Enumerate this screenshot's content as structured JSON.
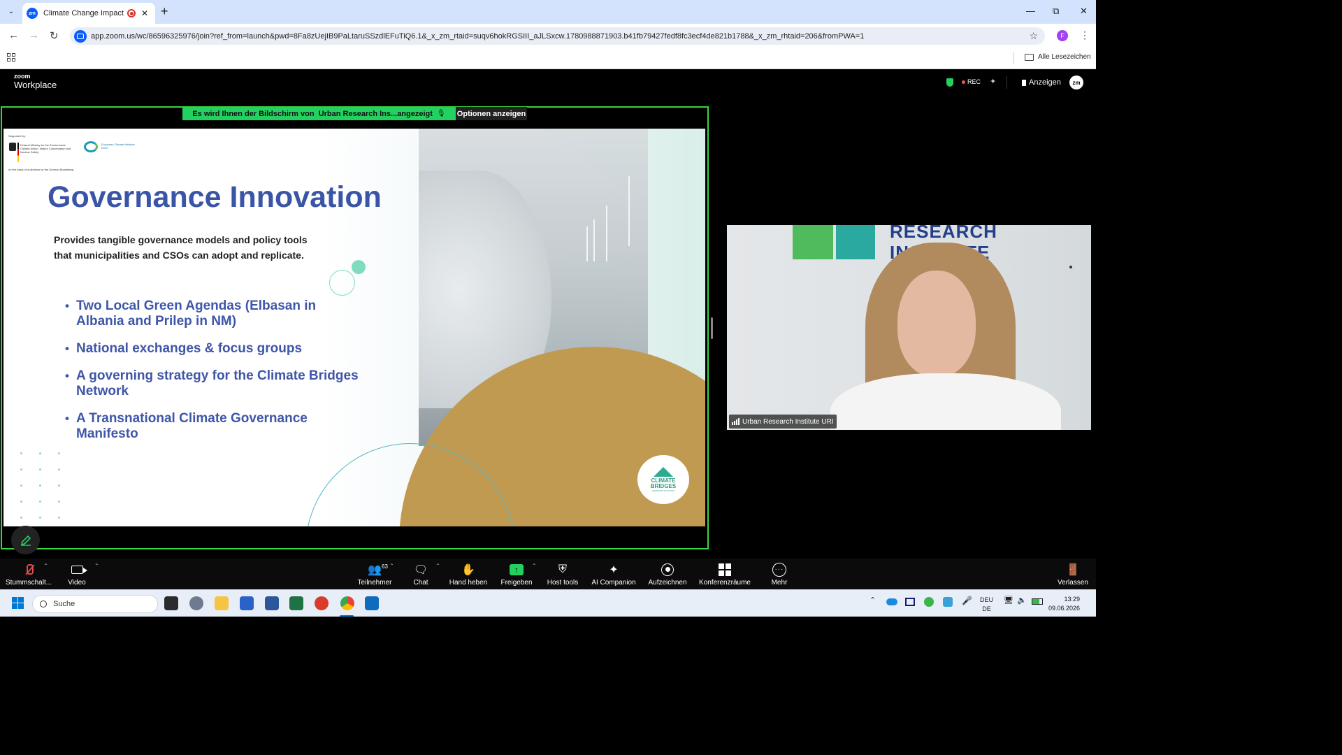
{
  "browser": {
    "tab_title": "Climate Change Impact Mit",
    "url": "app.zoom.us/wc/86596325976/join?ref_from=launch&pwd=8Fa8zUejIB9PaLtaruSSzdlEFuTiQ6.1&_x_zm_rtaid=suqv6hokRGSIII_aJLSxcw.1780988871903.b41fb79427fedf8fc3ecf4de821b1788&_x_zm_rhtaid=206&fromPWA=1",
    "profile_initial": "F",
    "bookmarks_label": "Alle Lesezeichen"
  },
  "zoom": {
    "logo_small": "zoom",
    "logo_big": "Workplace",
    "rec_label": "REC",
    "anzeigen_label": "Anzeigen",
    "avatar_label": "zm"
  },
  "share": {
    "banner_prefix": "Es wird Ihnen der Bildschirm von",
    "banner_name": "Urban Research Ins...angezeigt",
    "options_label": "Optionen anzeigen"
  },
  "slide": {
    "supported_by": "Supported by:",
    "ministry_text": "Federal Ministry for the Environment, Climate Action, Nature Conservation and Nuclear Safety",
    "euki_text": "European Climate Initiative EUKI",
    "basis_text": "on the basis of a decision by the German Bundestag",
    "title": "Governance Innovation",
    "subtitle": "Provides tangible governance models and policy tools that municipalities and CSOs can adopt and replicate.",
    "bullets": [
      "Two Local Green Agendas (Elbasan in Albania and Prilep in NM)",
      "National exchanges & focus groups",
      "A governing strategy for the Climate Bridges Network",
      "A Transnational Climate Governance Manifesto"
    ],
    "logo_line1": "CLIMATE",
    "logo_line2": "BRIDGES",
    "logo_line3": "NETWORK IN ACTION"
  },
  "video": {
    "wall_text": "RESEARCH\nINSTITUTE",
    "participant_name": "Urban Research Institute URI"
  },
  "controls": {
    "mute_label": "Stummschalt...",
    "video_label": "Video",
    "participants_label": "Teilnehmer",
    "participants_count": "63",
    "chat_label": "Chat",
    "raise_hand_label": "Hand heben",
    "share_label": "Freigeben",
    "host_tools_label": "Host tools",
    "ai_label": "AI Companion",
    "record_label": "Aufzeichnen",
    "rooms_label": "Konferenzräume",
    "more_label": "Mehr",
    "leave_label": "Verlassen"
  },
  "taskbar": {
    "search_placeholder": "Suche",
    "lang_line1": "DEU",
    "lang_line2": "DE",
    "time": "13:29",
    "date": "09.06.2026"
  },
  "colors": {
    "share_green": "#23d160",
    "slide_title_blue": "#3b55a6",
    "slide_gold": "#c19a52",
    "slide_mint": "#7fdcbf"
  }
}
